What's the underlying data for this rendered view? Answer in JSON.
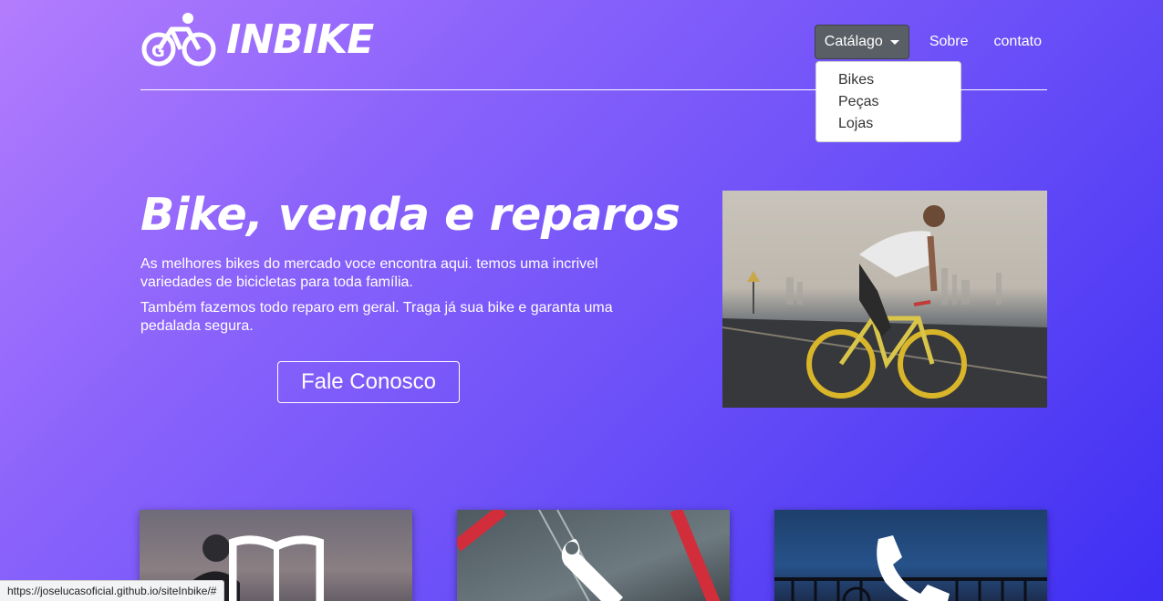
{
  "header": {
    "brand": "INBIKE",
    "nav": {
      "catalog_label": "Catálago",
      "about_label": "Sobre",
      "contact_label": "contato"
    },
    "dropdown_items": [
      "Bikes",
      "Peças",
      "Lojas"
    ]
  },
  "hero": {
    "title": "Bike, venda e reparos",
    "paragraph_1": "As melhores bikes do mercado voce encontra aqui. temos uma incrivel variedades de bicicletas para toda família.",
    "paragraph_2": "Também fazemos todo reparo em geral. Traga já sua bike e garanta uma pedalada segura.",
    "cta_label": "Fale Conosco"
  },
  "cards": [
    {
      "icon": "book-icon"
    },
    {
      "icon": "wrench-icon"
    },
    {
      "icon": "phone-icon"
    }
  ],
  "status_bar": {
    "url": "https://joselucasoficial.github.io/siteInbike/#"
  },
  "colors": {
    "gradient_start": "#b37dfd",
    "gradient_end": "#3f2ff3",
    "dropdown_button": "#5a5f66"
  }
}
